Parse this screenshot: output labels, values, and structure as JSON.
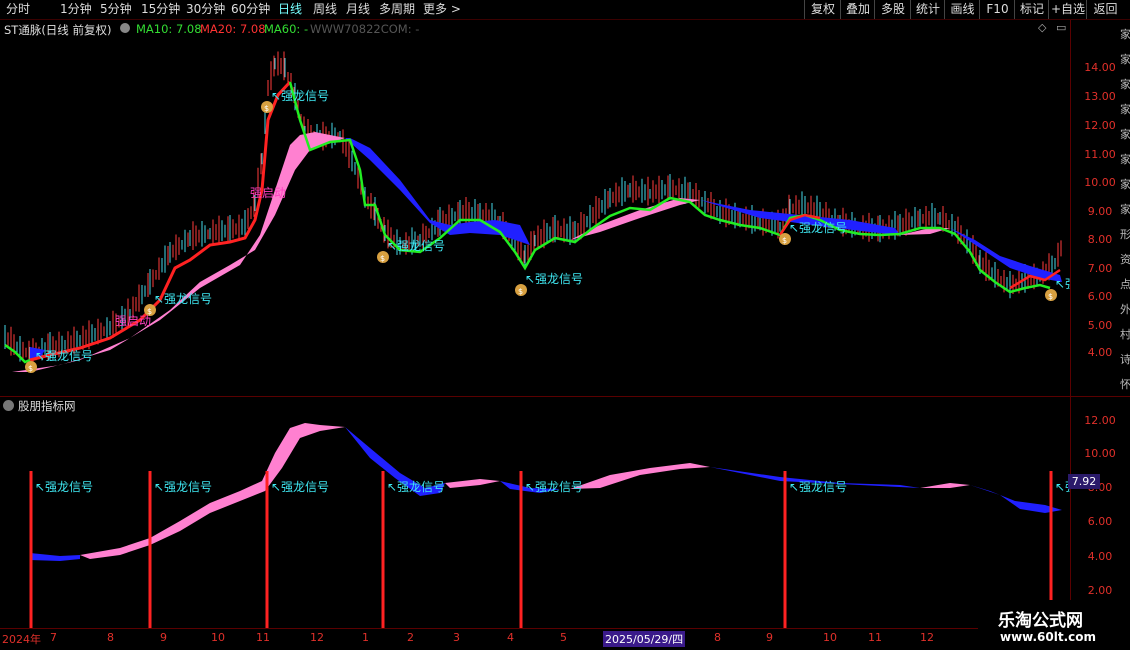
{
  "toolbar": {
    "periods": [
      "分时",
      "1分钟",
      "5分钟",
      "15分钟",
      "30分钟",
      "60分钟",
      "日线",
      "周线",
      "月线",
      "多周期",
      "更多 >"
    ],
    "active_period": "日线",
    "right_buttons": [
      "复权",
      "叠加",
      "多股",
      "统计",
      "画线",
      "F10",
      "标记",
      "+自选",
      "返回"
    ]
  },
  "main_panel": {
    "title": "ST通脉(日线 前复权)",
    "ma10_label": "MA10: 7.08",
    "ma20_label": "MA20: 7.08",
    "ma60_label": "MA60: -",
    "site_text": "WWW70822COM: -",
    "y_ticks": [
      "14.00",
      "13.00",
      "12.00",
      "11.00",
      "10.00",
      "9.00",
      "8.00",
      "7.00",
      "6.00",
      "5.00",
      "4.00"
    ],
    "signal_label": "强龙信号",
    "start_label": "强启动",
    "colors": {
      "ma10": "#33dd33",
      "ma20": "#ff3333",
      "ma60": "#ffffff",
      "band_up": "#ff80d0",
      "band_down": "#2020ff",
      "signal": "#3fe8f2"
    }
  },
  "sub_panel": {
    "title": "股朋指标网",
    "y_ticks": [
      "12.00",
      "10.00",
      "8.00",
      "6.00",
      "4.00",
      "2.00"
    ],
    "current_value": "7.92",
    "signal_label": "强龙信号"
  },
  "x_axis": {
    "labels": [
      "2024年",
      "7",
      "8",
      "9",
      "10",
      "11",
      "12",
      "1",
      "2",
      "3",
      "4",
      "5",
      "2025/05/29/四",
      "8",
      "9",
      "10",
      "11",
      "12"
    ]
  },
  "watermark": {
    "title": "乐淘公式网",
    "url": "www.60lt.com"
  },
  "right_strip_text": "家家家家家家家家形资点外村诗怀"
}
